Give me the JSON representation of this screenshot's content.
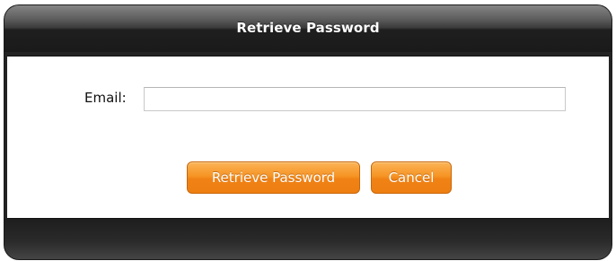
{
  "dialog": {
    "title": "Retrieve Password"
  },
  "form": {
    "email_label": "Email:",
    "email_value": "",
    "email_placeholder": ""
  },
  "buttons": {
    "retrieve_label": "Retrieve Password",
    "cancel_label": "Cancel"
  },
  "colors": {
    "button_accent": "#f28a1a",
    "frame": "#222222",
    "panel": "#ffffff"
  }
}
